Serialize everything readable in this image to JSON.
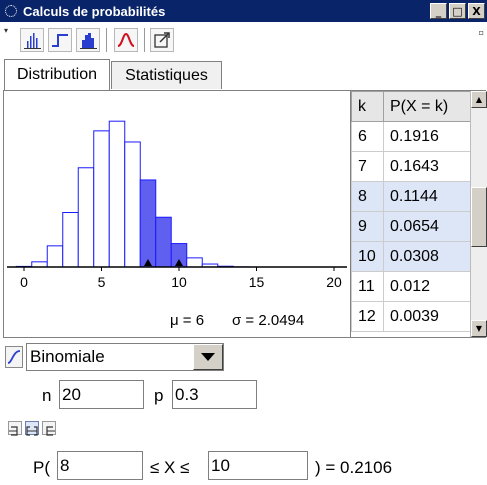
{
  "window": {
    "title": "Calculs de probabilités"
  },
  "title_buttons": [
    "_",
    "□",
    "X"
  ],
  "toolbar": {
    "buttons": [
      {
        "name": "bar-graph-icon"
      },
      {
        "name": "step-graph-icon"
      },
      {
        "name": "histogram-icon"
      },
      {
        "name": "normal-overlay-icon"
      },
      {
        "name": "export-icon"
      }
    ]
  },
  "tabs": [
    "Distribution",
    "Statistiques"
  ],
  "chart_data": {
    "type": "bar",
    "x_ticks": [
      0,
      5,
      10,
      15,
      20
    ],
    "x": [
      0,
      1,
      2,
      3,
      4,
      5,
      6,
      7,
      8,
      9,
      10,
      11,
      12,
      13,
      14,
      15,
      16,
      17,
      18,
      19,
      20
    ],
    "values": [
      0.0008,
      0.0068,
      0.0278,
      0.0716,
      0.1304,
      0.1789,
      0.1916,
      0.1643,
      0.1144,
      0.0654,
      0.0308,
      0.012,
      0.0039,
      0.001,
      0.0002,
      0,
      0,
      0,
      0,
      0,
      0
    ],
    "highlight_range": [
      8,
      10
    ],
    "highlight_color": "#6060f0",
    "outline_color": "#1a1aff",
    "markers": [
      8,
      10
    ],
    "xlim": [
      -2,
      21
    ],
    "stats": {
      "mu": "μ = 6",
      "sigma": "σ = 2.0494"
    }
  },
  "table": {
    "headers": [
      "k",
      "P(X = k)"
    ],
    "rows": [
      {
        "k": "6",
        "p": "0.1916",
        "selected": false
      },
      {
        "k": "7",
        "p": "0.1643",
        "selected": false
      },
      {
        "k": "8",
        "p": "0.1144",
        "selected": true
      },
      {
        "k": "9",
        "p": "0.0654",
        "selected": true
      },
      {
        "k": "10",
        "p": "0.0308",
        "selected": true
      },
      {
        "k": "11",
        "p": "0.012",
        "selected": false
      },
      {
        "k": "12",
        "p": "0.0039",
        "selected": false
      }
    ]
  },
  "distribution": {
    "selected": "Binomiale"
  },
  "params": {
    "n_label": "n",
    "n_value": "20",
    "p_label": "p",
    "p_value": "0.3"
  },
  "interval_modes": [
    {
      "name": "left-sided-mode-icon",
      "active": false
    },
    {
      "name": "interval-mode-icon",
      "active": true
    },
    {
      "name": "right-sided-mode-icon",
      "active": false
    }
  ],
  "probability": {
    "prefix": "P(",
    "low": "8",
    "middle": "≤ X ≤",
    "high": "10",
    "result": ") =  0.2106"
  }
}
